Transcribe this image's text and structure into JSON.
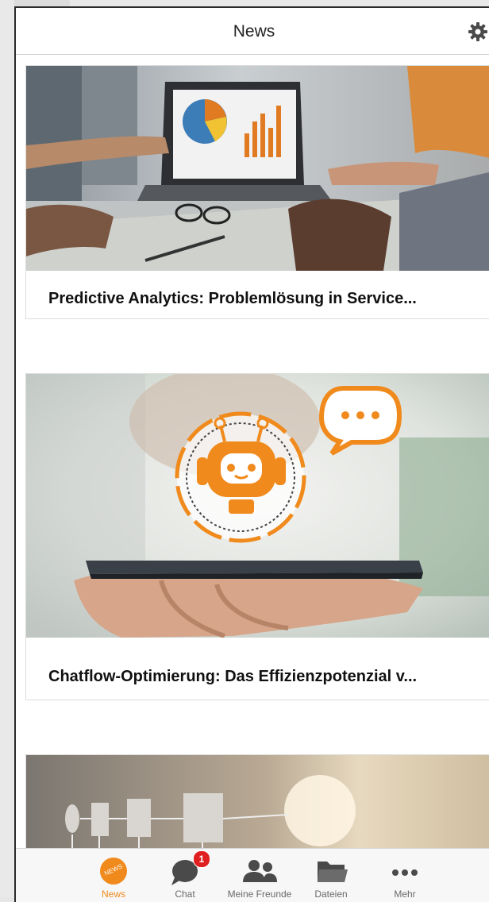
{
  "header": {
    "title": "News",
    "settings_icon": "gear-icon"
  },
  "articles": [
    {
      "title": "Predictive Analytics: Problemlösung in Service...",
      "image": "business-meeting-analytics-photo"
    },
    {
      "title": "Chatflow-Optimierung: Das Effizienzpotenzial v...",
      "image": "chatbot-hand-smartphone-photo"
    },
    {
      "title": "",
      "image": "process-flow-diagram-photo"
    }
  ],
  "tabbar": {
    "items": [
      {
        "label": "News",
        "icon": "news-icon",
        "active": true,
        "badge_text": "NEWS"
      },
      {
        "label": "Chat",
        "icon": "chat-icon",
        "badge": "1"
      },
      {
        "label": "Meine Freunde",
        "icon": "friends-icon"
      },
      {
        "label": "Dateien",
        "icon": "folder-icon"
      },
      {
        "label": "Mehr",
        "icon": "more-icon"
      }
    ]
  },
  "colors": {
    "accent": "#f08a1c",
    "badge": "#e02020"
  }
}
